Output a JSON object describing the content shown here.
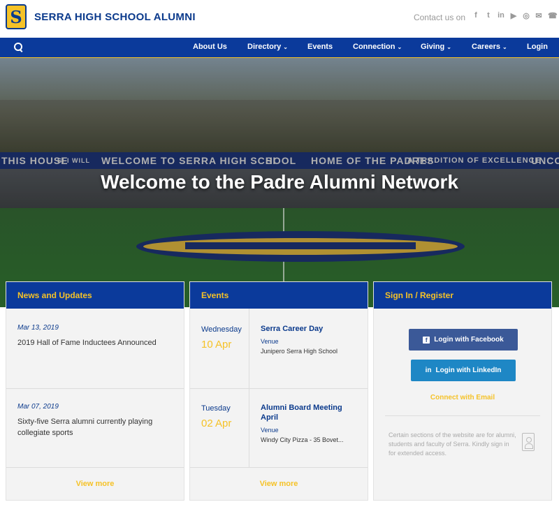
{
  "header": {
    "site_title": "SERRA HIGH SCHOOL ALUMNI",
    "logo_letter": "S",
    "contact_text": "Contact us on",
    "social_icons": [
      "facebook-icon",
      "twitter-icon",
      "linkedin-icon",
      "youtube-icon",
      "instagram-icon",
      "email-icon",
      "phone-icon"
    ]
  },
  "nav": {
    "items": [
      {
        "label": "About Us",
        "dropdown": false
      },
      {
        "label": "Directory",
        "dropdown": true
      },
      {
        "label": "Events",
        "dropdown": false
      },
      {
        "label": "Connection",
        "dropdown": true
      },
      {
        "label": "Giving",
        "dropdown": true
      },
      {
        "label": "Careers",
        "dropdown": true
      },
      {
        "label": "Login",
        "dropdown": false
      }
    ],
    "chevron": "⌄"
  },
  "hero": {
    "title": "Welcome to the Padre Alumni Network",
    "banner_segments": [
      "THIS HOUSE",
      "SI I WILL",
      "WELCOME TO SERRA HIGH SCHOOL",
      "SI",
      "HOME OF THE PADRES",
      "A TRADITION OF EXCELLENCE",
      "UNCO"
    ]
  },
  "news": {
    "heading": "News and Updates",
    "items": [
      {
        "date": "Mar 13, 2019",
        "text": "2019 Hall of Fame Inductees Announced"
      },
      {
        "date": "Mar 07, 2019",
        "text": "Sixty-five Serra alumni currently playing collegiate sports"
      }
    ],
    "view_more": "View more"
  },
  "events": {
    "heading": "Events",
    "items": [
      {
        "day": "Wednesday",
        "date": "10 Apr",
        "title": "Serra Career Day",
        "venue_label": "Venue",
        "venue": "Junipero Serra High School"
      },
      {
        "day": "Tuesday",
        "date": "02 Apr",
        "title": "Alumni Board Meeting April",
        "venue_label": "Venue",
        "venue": "Windy City Pizza - 35 Bovet..."
      }
    ],
    "view_more": "View more"
  },
  "signin": {
    "heading": "Sign In / Register",
    "facebook_label": "Login with Facebook",
    "linkedin_label": "Login with LinkedIn",
    "email_label": "Connect with Email",
    "note": "Certain sections of the website are for alumni, students and faculty of Serra. Kindly sign in for extended access."
  },
  "colors": {
    "brand_blue": "#0b3a9b",
    "brand_gold": "#f5c227",
    "facebook": "#3b5998",
    "linkedin": "#1e87c5"
  }
}
